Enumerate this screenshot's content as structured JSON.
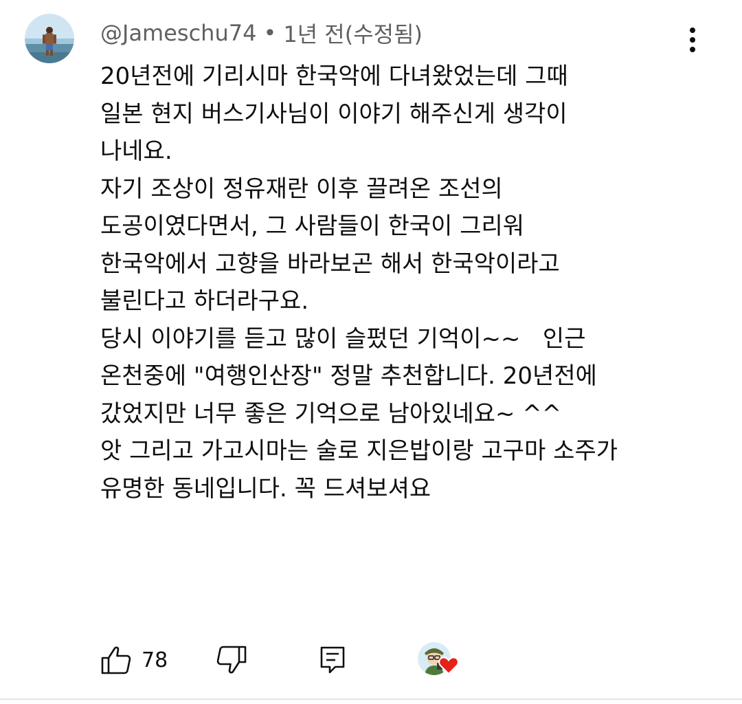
{
  "comment": {
    "author": "@Jameschu74",
    "separator": "•",
    "time": "1년 전(수정됨)",
    "body_lines": [
      "20년전에 기리시마 한국악에 다녀왔었는데 그때",
      "일본 현지 버스기사님이 이야기 해주신게 생각이",
      "나네요.",
      "자기 조상이 정유재란 이후 끌려온 조선의",
      "도공이였다면서, 그 사람들이 한국이 그리워",
      "한국악에서 고향을 바라보곤 해서 한국악이라고",
      "불린다고 하더라구요.",
      "당시 이야기를 듣고 많이 슬펐던 기억이~~   인근",
      "온천중에 \"여행인산장\" 정말 추천합니다. 20년전에",
      "갔었지만 너무 좋은 기억으로 남아있네요~ ^^",
      "앗 그리고 가고시마는 술로 지은밥이랑 고구마 소주가",
      "유명한 동네입니다. 꼭 드셔보셔요"
    ],
    "like_count": "78",
    "icons": {
      "more": "more-vert-icon",
      "like": "thumb-up-icon",
      "dislike": "thumb-down-icon",
      "reply": "reply-icon",
      "heart": "heart-icon"
    },
    "colors": {
      "meta_text": "#606060",
      "body_text": "#0f0f0f",
      "heart": "#e62117"
    }
  }
}
